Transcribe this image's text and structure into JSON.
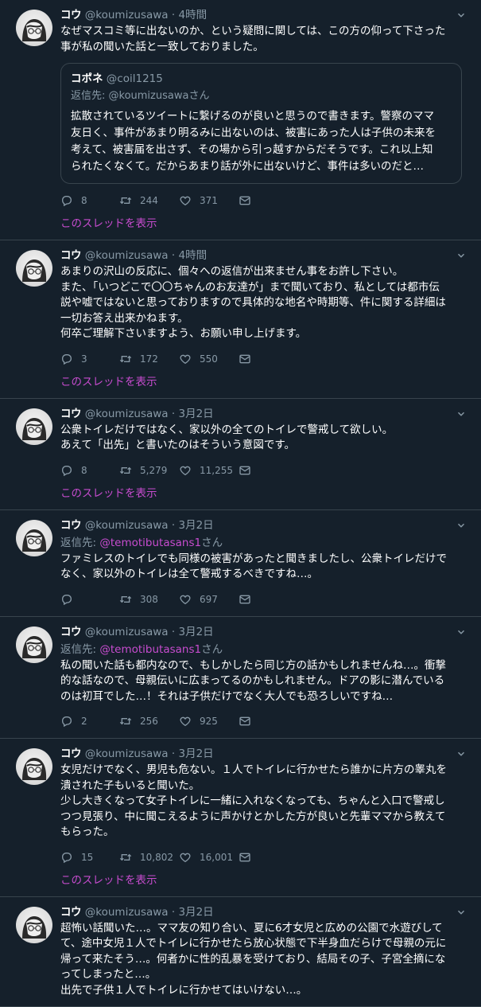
{
  "colors": {
    "background": "#15202b",
    "divider": "#38444d",
    "muted": "#8899a6",
    "accent": "#c74ccf"
  },
  "tweets": [
    {
      "name": "コウ",
      "handle": "@koumizusawa",
      "sep": "·",
      "time": "4時間",
      "text": "なぜマスコミ等に出ないのか、という疑問に関しては、この方の仰って下さった\n事が私の聞いた話と一致しておりました。",
      "quote": {
        "name": "コポネ",
        "handle": "@coil1215",
        "reply_to": "返信先: @koumizusawaさん",
        "text": "拡散されているツイートに繋げるのが良いと思うので書きます。警察のママ\n友日く、事件があまり明るみに出ないのは、被害にあった人は子供の未来を\n考えて、被害届を出さず、その場から引っ越すからだそうです。これ以上知\nられたくなくて。だからあまり話が外に出ないけど、事件は多いのだと…"
      },
      "replies": "8",
      "retweets": "244",
      "likes": "371",
      "thread_label": "このスレッドを表示"
    },
    {
      "name": "コウ",
      "handle": "@koumizusawa",
      "sep": "·",
      "time": "4時間",
      "text": "あまりの沢山の反応に、個々への返信が出来ません事をお許し下さい。\nまた、「いつどこで〇〇ちゃんのお友達が」まで聞いており、私としては都市伝\n説や嘘ではないと思っておりますので具体的な地名や時期等、件に関する詳細は\n一切お答え出来かねます。\n何卒ご理解下さいますよう、お願い申し上げます。",
      "replies": "3",
      "retweets": "172",
      "likes": "550",
      "thread_label": "このスレッドを表示"
    },
    {
      "name": "コウ",
      "handle": "@koumizusawa",
      "sep": "·",
      "time": "3月2日",
      "text": "公衆トイレだけではなく、家以外の全てのトイレで警戒して欲しい。\nあえて「出先」と書いたのはそういう意図です。",
      "replies": "8",
      "retweets": "5,279",
      "likes": "11,255",
      "thread_label": "このスレッドを表示"
    },
    {
      "name": "コウ",
      "handle": "@koumizusawa",
      "sep": "·",
      "time": "3月2日",
      "reply_prefix": "返信先: ",
      "reply_link": "@temotibutasans1",
      "reply_suffix": "さん",
      "text": "ファミレスのトイレでも同様の被害があったと聞きましたし、公衆トイレだけで\nなく、家以外のトイレは全て警戒するべきですね…。",
      "replies": "",
      "retweets": "308",
      "likes": "697"
    },
    {
      "name": "コウ",
      "handle": "@koumizusawa",
      "sep": "·",
      "time": "3月2日",
      "reply_prefix": "返信先: ",
      "reply_link": "@temotibutasans1",
      "reply_suffix": "さん",
      "text": "私の聞いた話も都内なので、もしかしたら同じ方の話かもしれませんね…。衝撃\n的な話なので、母親伝いに広まってるのかもしれません。ドアの影に潜んでいる\nのは初耳でした…！それは子供だけでなく大人でも恐ろしいですね…",
      "replies": "2",
      "retweets": "256",
      "likes": "925"
    },
    {
      "name": "コウ",
      "handle": "@koumizusawa",
      "sep": "·",
      "time": "3月2日",
      "text": "女児だけでなく、男児も危ない。１人でトイレに行かせたら誰かに片方の睾丸を\n潰された子もいると聞いた。\n少し大きくなって女子トイレに一緒に入れなくなっても、ちゃんと入口で警戒し\nつつ見張り、中に聞こえるように声かけとかした方が良いと先輩ママから教えて\nもらった。",
      "replies": "15",
      "retweets": "10,802",
      "likes": "16,001",
      "thread_label": "このスレッドを表示"
    },
    {
      "name": "コウ",
      "handle": "@koumizusawa",
      "sep": "·",
      "time": "3月2日",
      "text": "超怖い話聞いた…。ママ友の知り合い、夏に6才女児と広めの公園で水遊びして\nて、途中女児１人でトイレに行かせたら放心状態で下半身血だらけで母親の元に\n帰って来たそう…。何者かに性的乱暴を受けており、結局その子、子宮全摘にな\nってしまったと…。\n出先で子供１人でトイレに行かせてはいけない…。"
    }
  ]
}
